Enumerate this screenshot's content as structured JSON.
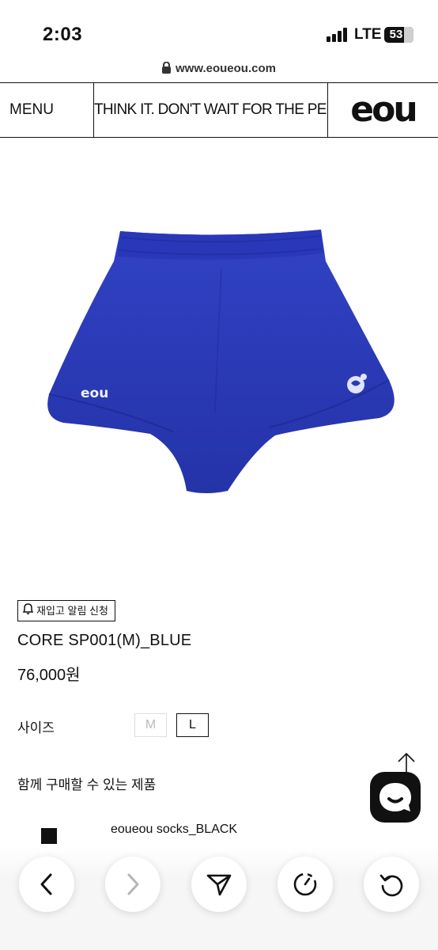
{
  "status_bar": {
    "time": "2:03",
    "network": "LTE",
    "battery": "53"
  },
  "browser": {
    "url": "www.eoueou.com"
  },
  "header": {
    "menu_label": "MENU",
    "marquee_text": "THINK IT. DON'T WAIT FOR THE PERFECT MOMENT",
    "logo": "eou"
  },
  "product": {
    "restock_label": "재입고 알림 신청",
    "name": "CORE SP001(M)_BLUE",
    "price": "76,000원",
    "color": "#2c3bb5",
    "print_text": "eou",
    "size_label": "사이즈",
    "sizes": [
      {
        "label": "M",
        "available": false
      },
      {
        "label": "L",
        "available": true
      }
    ]
  },
  "related": {
    "title": "함께 구매할 수 있는 제품",
    "items": [
      {
        "name": "eoueou socks_BLACK"
      }
    ]
  },
  "icons": {
    "nav": [
      "back-icon",
      "forward-icon",
      "share-icon",
      "speed-dial-icon",
      "reload-icon"
    ],
    "chat": "chat-icon",
    "scroll": "scroll-top-icon"
  }
}
